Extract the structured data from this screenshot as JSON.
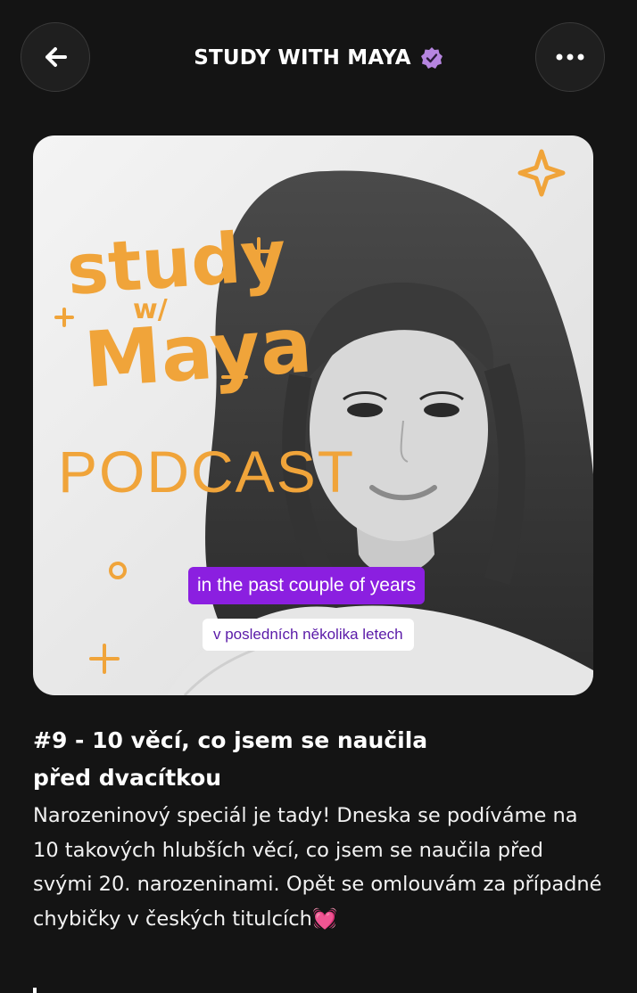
{
  "header": {
    "title": "STUDY WITH MAYA",
    "verified_badge_color": "#b685e0"
  },
  "cover": {
    "art_text": {
      "study": "study",
      "with": "w/",
      "maya": "Maya",
      "podcast": "PODCAST"
    },
    "caption_en": "in the past couple of years",
    "caption_cz": "v posledních několika letech",
    "accent_color": "#f0a43a",
    "caption_color": "#8b1fe0"
  },
  "episode": {
    "title_line1": "#9 - 10 věcí, co jsem se naučila",
    "title_line2": "před dvacítkou",
    "description": "Narozeninový speciál je tady! Dneska se podíváme na 10 takových hlubších věcí, co jsem se naučila před svými 20. narozeninami. Opět se omlouvám za případné chybičky v českých titulcích",
    "description_emoji": "💓"
  },
  "icons": {
    "back": "arrow-left-icon",
    "more": "more-horizontal-icon",
    "verified": "verified-badge-icon",
    "heart": "heart-emoji-icon"
  }
}
